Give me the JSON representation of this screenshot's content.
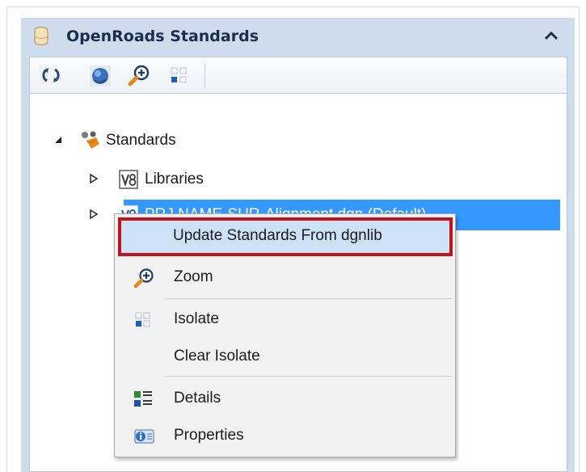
{
  "panel": {
    "title": "OpenRoads Standards",
    "header_icon": "database-icon",
    "collapse_icon": "chevron-up-icon",
    "background": "#cfdcee"
  },
  "toolbar": {
    "buttons": [
      {
        "name": "refresh-icon"
      },
      {
        "name": "globe-icon"
      },
      {
        "name": "zoom-icon"
      },
      {
        "name": "isolate-icon"
      }
    ]
  },
  "tree": {
    "root": {
      "label": "Standards",
      "icon": "standards-icon",
      "expanded": true
    },
    "children": [
      {
        "label": "Libraries",
        "icon": "v8-file-icon",
        "expanded": false,
        "selected": false
      },
      {
        "label": "PRJ NAME-SUR-Alignment.dgn (Default)",
        "icon": "v8-file-icon",
        "expanded": false,
        "selected": true
      }
    ],
    "selection_color": "#3399ff"
  },
  "context_menu": {
    "items": [
      {
        "label": "Update Standards From dgnlib",
        "icon": "",
        "highlighted": true
      },
      {
        "label": "Zoom",
        "icon": "zoom-icon"
      },
      {
        "label": "Isolate",
        "icon": "isolate-icon"
      },
      {
        "label": "Clear Isolate",
        "icon": ""
      },
      {
        "label": "Details",
        "icon": "details-icon"
      },
      {
        "label": "Properties",
        "icon": "properties-icon"
      }
    ],
    "highlight_border_color": "#c0141c"
  }
}
